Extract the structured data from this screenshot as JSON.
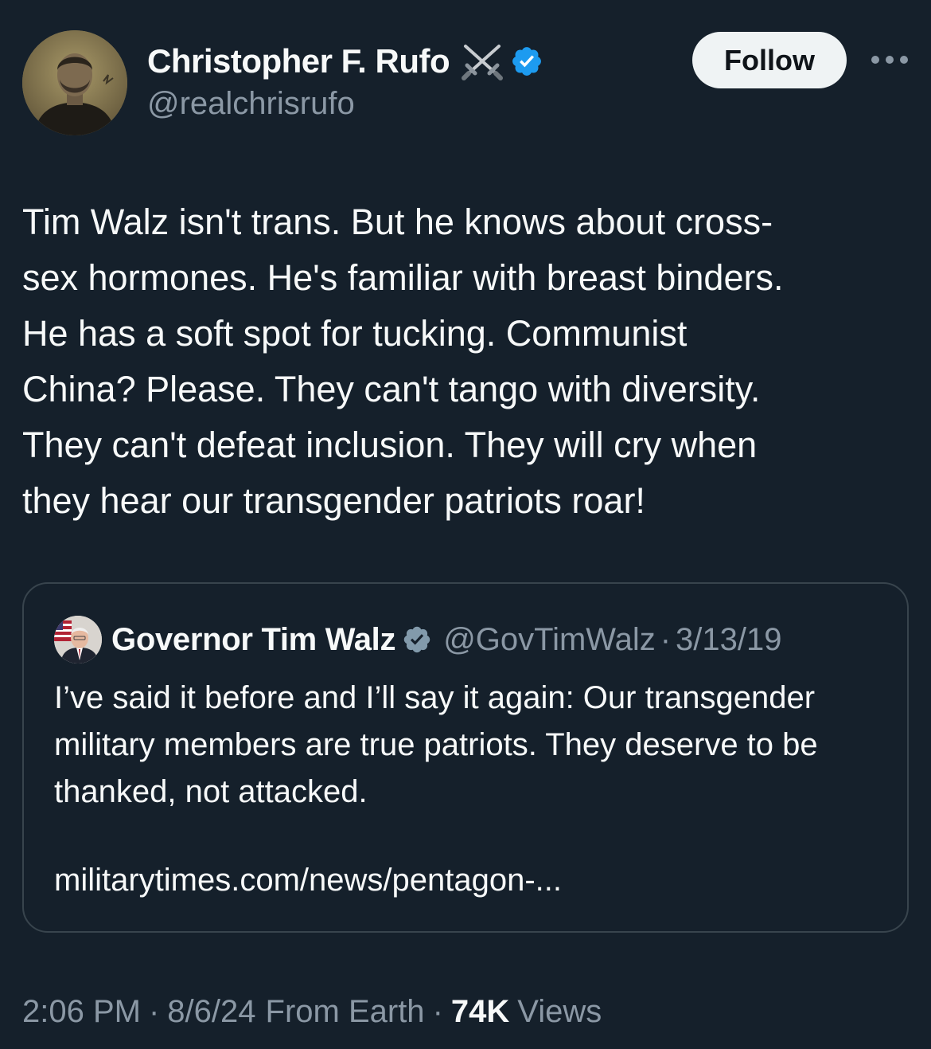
{
  "author": {
    "display_name": "Christopher F. Rufo",
    "handle": "@realchrisrufo",
    "avatar_icon": "profile-photo",
    "name_emoji_icon": "crossed-swords-icon",
    "verified_icon": "verified-badge-icon",
    "verified_color": "#1d9bf0"
  },
  "actions": {
    "follow_label": "Follow",
    "more_icon": "more-options-icon"
  },
  "tweet": {
    "text": "Tim Walz isn't trans. But he knows about cross-\nsex hormones. He's familiar with breast binders.\nHe has a soft spot for tucking. Communist\nChina? Please. They can't tango with diversity.\nThey can't defeat inclusion. They will cry when\nthey hear our transgender patriots roar!"
  },
  "quote": {
    "display_name": "Governor Tim Walz",
    "handle": "@GovTimWalz",
    "separator": "·",
    "date": "3/13/19",
    "verified_icon": "verified-badge-icon",
    "verified_color": "#829aab",
    "text": "I’ve said it before and I’ll say it again: Our transgender military members are true patriots. They deserve to be thanked, not attacked.",
    "link": "militarytimes.com/news/pentagon-..."
  },
  "meta": {
    "time": "2:06 PM",
    "separator": "·",
    "date": "8/6/24",
    "source": "From Earth",
    "views_count": "74K",
    "views_label": "Views"
  },
  "colors": {
    "background": "#15202b",
    "text_primary": "#f7f9f9",
    "text_secondary": "#8b98a5",
    "border": "#38444d",
    "follow_bg": "#eff3f4"
  }
}
